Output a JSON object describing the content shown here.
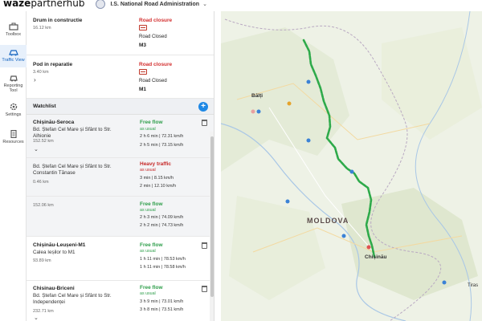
{
  "app": {
    "logo_bold": "waze",
    "logo_light": "partnerhub",
    "org_name": "I.S. National Road Administration"
  },
  "rail": [
    {
      "label": "Toolbox",
      "icon": "toolbox-icon"
    },
    {
      "label": "Traffic View",
      "icon": "traffic-view-icon",
      "active": true
    },
    {
      "label": "Reporting Tool",
      "icon": "reporting-tool-icon"
    },
    {
      "label": "Settings",
      "icon": "settings-icon"
    },
    {
      "label": "Resources",
      "icon": "resources-icon"
    }
  ],
  "alerts": [
    {
      "title": "Drum in constructie",
      "distance": "16.12 km",
      "type": "Road closure",
      "status": "Road Closed",
      "road": "M3"
    },
    {
      "title": "Pod in reparatie",
      "distance": "3.40 km",
      "type": "Road closure",
      "status": "Road Closed",
      "road": "M1"
    }
  ],
  "watchlist": {
    "label": "Watchlist",
    "add_label": "+",
    "items": [
      {
        "title": "Chișinău-Seroca",
        "route": "Bd. Ștefan Cel Mare și Sfânt to Str. Alhionie",
        "distance": "152.52 km",
        "status": "Free flow",
        "usual": "as usual",
        "metric1": "2 h 6 min | 72.31 km/h",
        "metric2": "2 h 5 min | 73.15 km/h"
      },
      {
        "title": "",
        "route": "Bd. Ștefan Cel Mare și Sfânt to Str. Constantin Tănase",
        "distance": "0.46 km",
        "status": "Heavy traffic",
        "usual": "as usual",
        "metric1": "3 min | 8.15 km/h",
        "metric2": "2 min | 12.10 km/h"
      },
      {
        "title": "",
        "route": "",
        "distance": "152.06 km",
        "status": "Free flow",
        "usual": "as usual",
        "metric1": "2 h 3 min | 74.09 km/h",
        "metric2": "2 h 2 min | 74.73 km/h"
      },
      {
        "title": "Chișinău-Leușeni-M1",
        "route": "Calea Ieșilor to M1",
        "distance": "93.89 km",
        "status": "Free flow",
        "usual": "as usual",
        "metric1": "1 h 11 min | 78.53 km/h",
        "metric2": "1 h 11 min | 78.58 km/h"
      },
      {
        "title": "Chisinau-Briceni",
        "route": "Bd. Ștefan Cel Mare și Sfânt to Str. Independenței",
        "distance": "232.71 km",
        "status": "Free flow",
        "usual": "as usual",
        "metric1": "3 h 9 min | 73.01 km/h",
        "metric2": "3 h 8 min | 73.51 km/h"
      }
    ]
  },
  "map": {
    "country_label": "MOLDOVA",
    "cities": [
      "Bălți",
      "Chișinău",
      "Tiras"
    ],
    "route_color": "#2eaa4a",
    "marker_color": "#3b82d6"
  }
}
